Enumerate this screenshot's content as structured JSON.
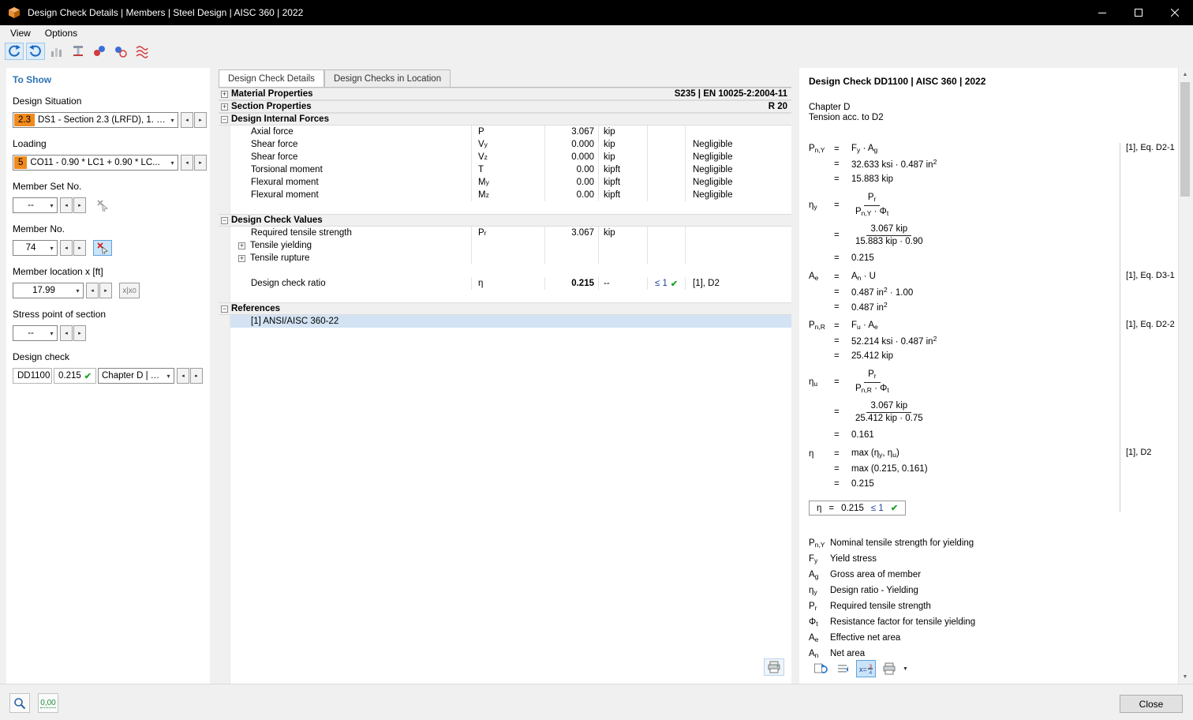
{
  "titlebar": {
    "title": "Design Check Details | Members | Steel Design | AISC 360 | 2022"
  },
  "menubar": {
    "view": "View",
    "options": "Options"
  },
  "ui": {
    "eq": "=",
    "prev": "◂",
    "next": "▸",
    "dropdown": "▾",
    "plus": "+",
    "minus": "−",
    "check": "✔",
    "up": "▲",
    "down": "▼"
  },
  "panel": {
    "header": "To Show",
    "design_situation": {
      "label": "Design Situation",
      "badge": "2.3",
      "value": "DS1 - Section 2.3 (LRFD), 1. t..."
    },
    "loading": {
      "label": "Loading",
      "badge": "5",
      "value": "CO11 - 0.90 * LC1 + 0.90 * LC..."
    },
    "member_set": {
      "label": "Member Set No.",
      "value": "--"
    },
    "member": {
      "label": "Member No.",
      "value": "74"
    },
    "location": {
      "label": "Member location x [ft]",
      "value": "17.99",
      "x_button": "x|x_{0}"
    },
    "stress_point": {
      "label": "Stress point of section",
      "value": "--"
    },
    "design_check": {
      "label": "Design check",
      "code": "DD1100",
      "ratio": "0.215",
      "chapter": "Chapter D | T..."
    }
  },
  "tabs": {
    "details": "Design Check Details",
    "in_location": "Design Checks in Location"
  },
  "table": {
    "material": {
      "label": "Material Properties",
      "right": "S235 | EN 10025-2:2004-11"
    },
    "section": {
      "label": "Section Properties",
      "right": "R 20"
    },
    "internal_forces": {
      "label": "Design Internal Forces"
    },
    "rows_forces": [
      {
        "label": "Axial force",
        "sym": "P",
        "value": "3.067",
        "unit": "kip",
        "note": ""
      },
      {
        "label": "Shear force",
        "sym": "V_{y}",
        "value": "0.000",
        "unit": "kip",
        "note": "Negligible"
      },
      {
        "label": "Shear force",
        "sym": "V_{z}",
        "value": "0.000",
        "unit": "kip",
        "note": "Negligible"
      },
      {
        "label": "Torsional moment",
        "sym": "T",
        "value": "0.00",
        "unit": "kipft",
        "note": "Negligible"
      },
      {
        "label": "Flexural moment",
        "sym": "M_{y}",
        "value": "0.00",
        "unit": "kipft",
        "note": "Negligible"
      },
      {
        "label": "Flexural moment",
        "sym": "M_{z}",
        "value": "0.00",
        "unit": "kipft",
        "note": "Negligible"
      }
    ],
    "check_values": {
      "label": "Design Check Values"
    },
    "required": {
      "label": "Required tensile strength",
      "sym": "P_{r}",
      "value": "3.067",
      "unit": "kip"
    },
    "tensile_yielding": {
      "label": "Tensile yielding"
    },
    "tensile_rupture": {
      "label": "Tensile rupture"
    },
    "ratio": {
      "label": "Design check ratio",
      "sym": "η",
      "value": "0.215",
      "unit": "--",
      "criterion": "≤ 1",
      "ref": "[1], D2"
    },
    "references": {
      "label": "References"
    },
    "reference_item": {
      "label": "[1]  ANSI/AISC 360-22"
    }
  },
  "details": {
    "title": "Design Check DD1100 | AISC 360 | 2022",
    "chapter": "Chapter D",
    "subtitle": "Tension acc. to D2",
    "blocks": {
      "pny": {
        "lhs": "P_{n,Y}",
        "rhs1": "F_{y}  ·  A_{g}",
        "rhs2": "32.633 ksi  ·  0.487 in^{2}",
        "rhs3": "15.883 kip",
        "ref": "[1], Eq. D2-1"
      },
      "etay": {
        "lhs": "η_{y}",
        "num1": "P_{r}",
        "den1": "P_{n,Y}  ·  Φ_{t}",
        "num2": "3.067 kip",
        "den2": "15.883 kip  ·  0.90",
        "rhs3": "0.215"
      },
      "ae": {
        "lhs": "A_{e}",
        "rhs1": "A_{n}  ·  U",
        "rhs2": "0.487 in^{2}  ·  1.00",
        "rhs3": "0.487 in^{2}",
        "ref": "[1], Eq. D3-1"
      },
      "pnr": {
        "lhs": "P_{n,R}",
        "rhs1": "F_{u}  ·  A_{e}",
        "rhs2": "52.214 ksi  ·  0.487 in^{2}",
        "rhs3": "25.412 kip",
        "ref": "[1], Eq. D2-2"
      },
      "etau": {
        "lhs": "η_{u}",
        "num1": "P_{r}",
        "den1": "P_{n,R}  ·  Φ_{t}",
        "num2": "3.067 kip",
        "den2": "25.412 kip  ·  0.75",
        "rhs3": "0.161"
      },
      "eta": {
        "lhs": "η",
        "rhs1": "max (η_{y},  η_{u})",
        "rhs2": "max (0.215,  0.161)",
        "rhs3": "0.215",
        "ref": "[1], D2"
      }
    },
    "result": {
      "lhs": "η",
      "value": "0.215",
      "criterion": "≤ 1"
    },
    "legend": [
      {
        "sym": "P_{n,Y}",
        "desc": "Nominal tensile strength for yielding"
      },
      {
        "sym": "F_{y}",
        "desc": "Yield stress"
      },
      {
        "sym": "A_{g}",
        "desc": "Gross area of member"
      },
      {
        "sym": "η_{y}",
        "desc": "Design ratio - Yielding"
      },
      {
        "sym": "P_{r}",
        "desc": "Required tensile strength"
      },
      {
        "sym": "Φ_{t}",
        "desc": "Resistance factor for tensile yielding"
      },
      {
        "sym": "A_{e}",
        "desc": "Effective net area"
      },
      {
        "sym": "A_{n}",
        "desc": "Net area"
      }
    ]
  },
  "statusbar": {
    "decimal": "0,00",
    "close": "Close"
  }
}
